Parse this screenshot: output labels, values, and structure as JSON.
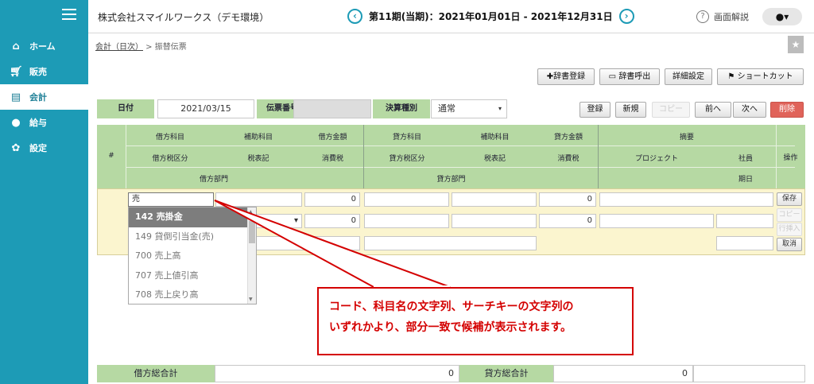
{
  "sidebar": {
    "items": [
      {
        "label": "ホーム",
        "icon": "home-icon"
      },
      {
        "label": "販売",
        "icon": "cart-icon"
      },
      {
        "label": "会計",
        "icon": "ledger-icon"
      },
      {
        "label": "給与",
        "icon": "money-bag-icon"
      },
      {
        "label": "設定",
        "icon": "gear-icon"
      }
    ]
  },
  "header": {
    "company": "株式会社スマイルワークス（デモ環境）",
    "period": "第11期(当期)：2021年01月01日 - 2021年12月31日",
    "help": "画面解説"
  },
  "breadcrumb": {
    "parent": "会計（日次）",
    "sep": " > ",
    "current": "振替伝票"
  },
  "toolbar": {
    "dict_register": "✚辞書登録",
    "dict_call": "辞書呼出",
    "detail_settings": "詳細設定",
    "shortcut": "ショートカット"
  },
  "form": {
    "date_label": "日付",
    "date_value": "2021/03/15",
    "slip_label": "伝票番号",
    "slip_value": "",
    "settle_label": "決算種別",
    "settle_value": "通常"
  },
  "actions": {
    "register": "登録",
    "new": "新規",
    "copy": "コピー",
    "prev": "前へ",
    "next": "次へ",
    "delete": "削除"
  },
  "grid": {
    "hash": "#",
    "debit": {
      "account": "借方科目",
      "sub": "補助科目",
      "amount": "借方金額",
      "taxcat": "借方税区分",
      "taxnote": "税表記",
      "tax": "消費税",
      "dept": "借方部門"
    },
    "credit": {
      "account": "貸方科目",
      "sub": "補助科目",
      "amount": "貸方金額",
      "taxcat": "貸方税区分",
      "taxnote": "税表記",
      "tax": "消費税",
      "dept": "貸方部門"
    },
    "summary": "摘要",
    "project": "プロジェクト",
    "employee": "社員",
    "due": "期日",
    "ops": "操作",
    "row": {
      "debit_account_input": "売",
      "debit_amount": "0",
      "debit_tax": "0",
      "credit_amount": "0",
      "credit_tax": "0"
    },
    "buttons": {
      "save": "保存",
      "copy": "コピー",
      "insert": "行挿入",
      "cancel": "取消"
    }
  },
  "dropdown": {
    "options": [
      "142 売掛金",
      "149 貸倒引当金(売)",
      "700 売上高",
      "707 売上値引高",
      "708 売上戻り高"
    ],
    "selected_index": 0
  },
  "callout": {
    "line1": "コード、科目名の文字列、サーチキーの文字列の",
    "line2": "いずれかより、部分一致で候補が表示されます。"
  },
  "totals": {
    "debit_label": "借方総合計",
    "debit_value": "0",
    "credit_label": "貸方総合計",
    "credit_value": "0"
  },
  "colors": {
    "sidebar": "#1d9bb6",
    "label_green": "#b6d9a3",
    "row_yellow": "#fbf5cf",
    "callout_red": "#d40000",
    "delete_red": "#e0635a"
  }
}
